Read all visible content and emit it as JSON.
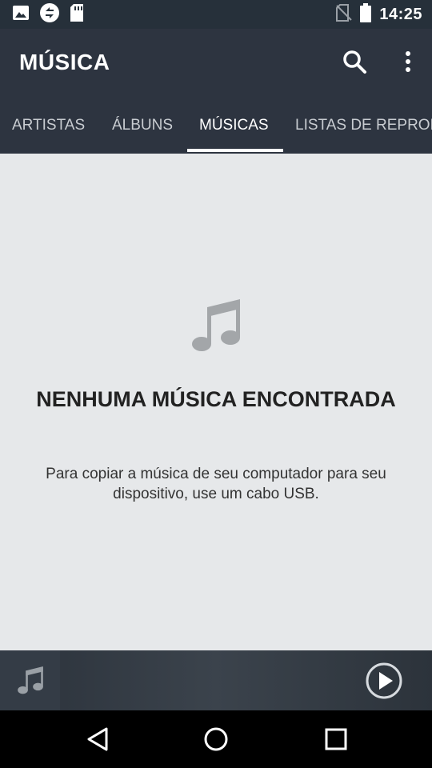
{
  "status_bar": {
    "time": "14:25",
    "icons": [
      "image-icon",
      "sync-icon",
      "sd-card-icon",
      "no-sim-icon",
      "battery-icon"
    ]
  },
  "app_bar": {
    "title": "MÚSICA",
    "actions": [
      "search-icon",
      "more-vert-icon"
    ]
  },
  "tabs": [
    {
      "label": "ARTISTAS",
      "active": false
    },
    {
      "label": "ÁLBUNS",
      "active": false
    },
    {
      "label": "MÚSICAS",
      "active": true
    },
    {
      "label": "LISTAS DE REPRODUÇÃO",
      "active": false
    }
  ],
  "empty_state": {
    "icon": "music-note-icon",
    "title": "NENHUMA MÚSICA ENCONTRADA",
    "description": "Para copiar a música de seu computador para seu dispositivo, use um cabo USB."
  },
  "mini_player": {
    "art_icon": "music-note-icon",
    "control_icon": "play-icon"
  },
  "nav_bar": [
    "back-icon",
    "home-icon",
    "recents-icon"
  ],
  "colors": {
    "status_bar": "#26303a",
    "app_bar": "#2d3440",
    "background": "#e6e8ea",
    "nav_bar": "#000000"
  }
}
